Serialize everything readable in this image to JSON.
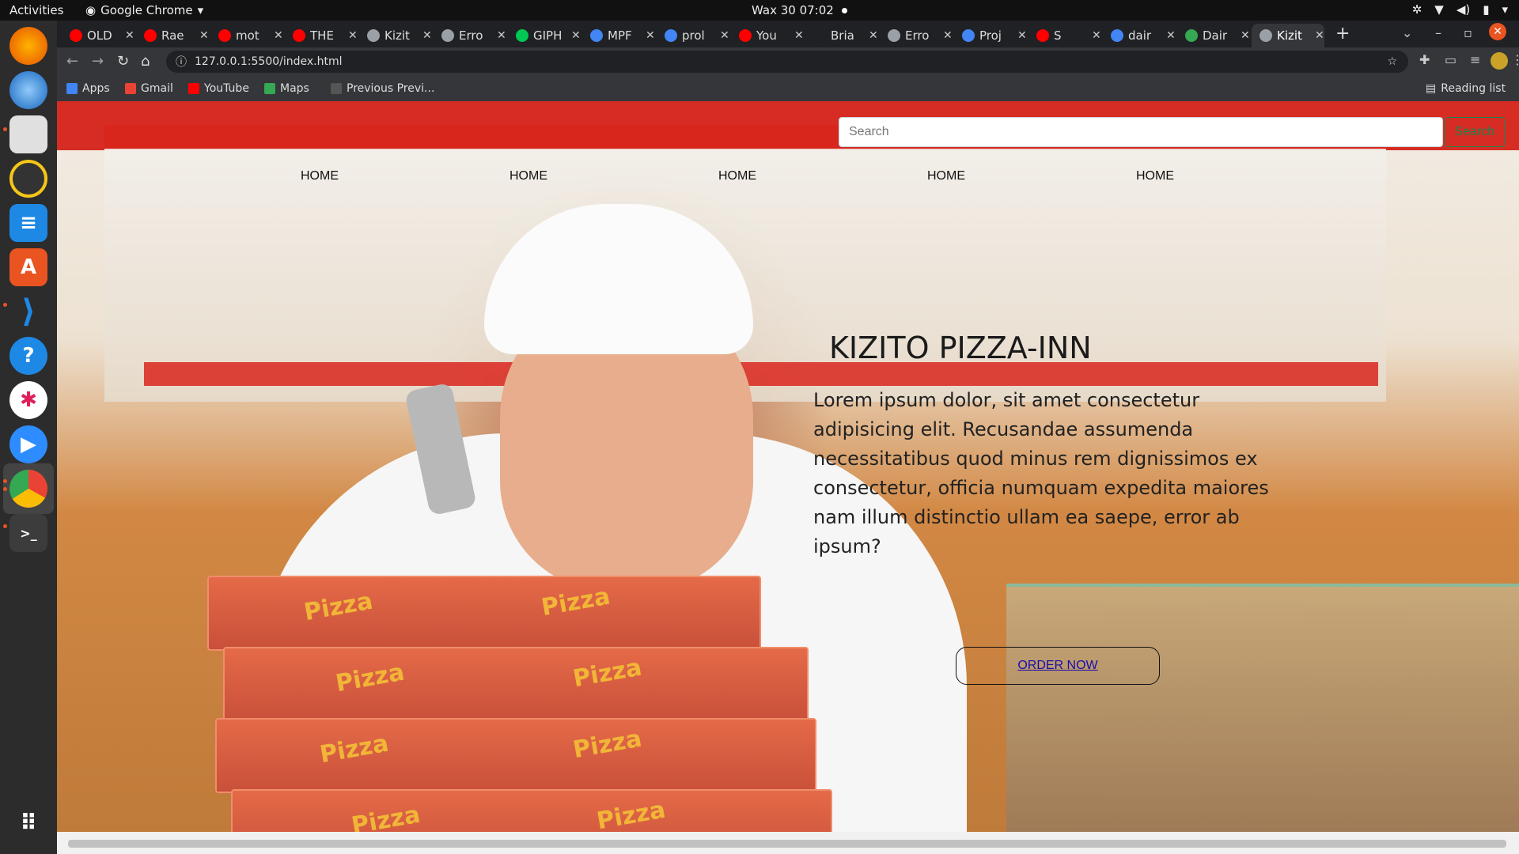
{
  "system": {
    "activities": "Activities",
    "app_name": "Google Chrome",
    "clock": "Wax 30  07:02"
  },
  "dock": [
    "firefox-icon",
    "thunderbird-icon",
    "files-icon",
    "rhythmbox-icon",
    "writer-icon",
    "app-center-icon",
    "vscode-icon",
    "help-icon",
    "slack-icon",
    "zoom-icon",
    "chrome-icon",
    "terminal-icon",
    "apps-grid-icon"
  ],
  "tabs": [
    {
      "label": "OLD",
      "color": "#ff0000"
    },
    {
      "label": "Rae",
      "color": "#ff0000"
    },
    {
      "label": "mot",
      "color": "#ff0000"
    },
    {
      "label": "THE",
      "color": "#ff0000"
    },
    {
      "label": "Kizit",
      "color": "#9aa0a6"
    },
    {
      "label": "Erro",
      "color": "#9aa0a6"
    },
    {
      "label": "GIPH",
      "color": "#00c853"
    },
    {
      "label": "MPF",
      "color": "#4285f4"
    },
    {
      "label": "prol",
      "color": "#4285f4"
    },
    {
      "label": "You",
      "color": "#ff0000"
    },
    {
      "label": "Bria",
      "color": "#202124"
    },
    {
      "label": "Erro",
      "color": "#9aa0a6"
    },
    {
      "label": "Proj",
      "color": "#4285f4"
    },
    {
      "label": "S",
      "color": "#ff0000"
    },
    {
      "label": "dair",
      "color": "#4285f4"
    },
    {
      "label": "Dair",
      "color": "#34a853"
    },
    {
      "label": "Kizit",
      "color": "#9aa0a6"
    }
  ],
  "address_bar": {
    "url": "127.0.0.1:5500/index.html"
  },
  "bookmarks": [
    {
      "label": "Apps",
      "color": "#4285f4"
    },
    {
      "label": "Gmail",
      "color": "#ea4335"
    },
    {
      "label": "YouTube",
      "color": "#ff0000"
    },
    {
      "label": "Maps",
      "color": "#34a853"
    },
    {
      "label": "Previous Previ...",
      "color": "#555555"
    }
  ],
  "reading_list": "Reading list",
  "page": {
    "search_placeholder": "Search",
    "search_button": "Search",
    "nav": [
      "HOME",
      "HOME",
      "HOME",
      "HOME",
      "HOME"
    ],
    "title": "KIZITO PIZZA-INN",
    "body": "Lorem ipsum dolor, sit amet consectetur adipisicing elit. Recusandae assumenda necessitatibus quod minus rem dignissimos ex consectetur, officia numquam expedita maiores nam illum distinctio ullam ea saepe, error ab ipsum?",
    "order_button": "ORDER NOW",
    "box_text": "Pizza"
  },
  "colors": {
    "search_button": "#198754",
    "link": "#1a0dab"
  }
}
